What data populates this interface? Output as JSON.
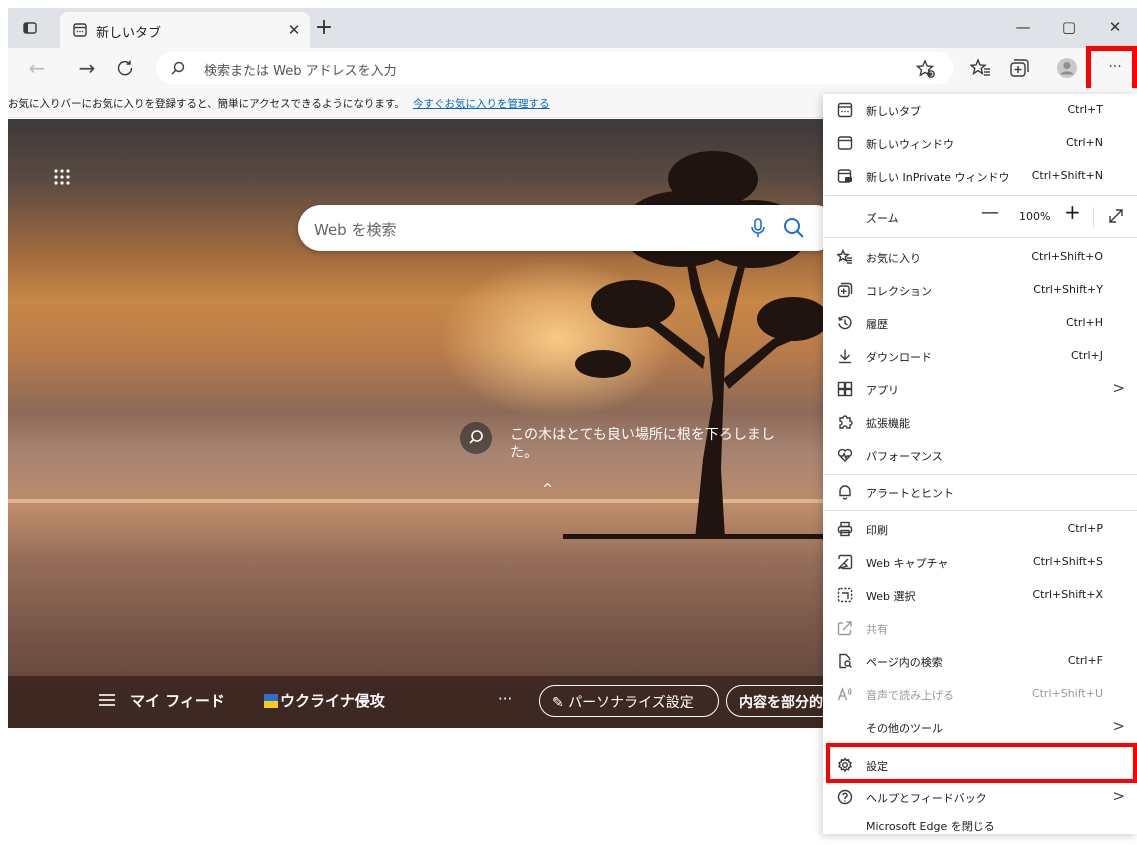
{
  "tab": {
    "title": "新しいタブ"
  },
  "window_controls": {
    "minimize": "—",
    "maximize": "▢",
    "close": "✕"
  },
  "address_bar": {
    "placeholder": "検索または Web アドレスを入力"
  },
  "favorites_bar": {
    "message": "お気に入りバーにお気に入りを登録すると、簡単にアクセスできるようになります。",
    "link": "今すぐお気に入りを管理する"
  },
  "page": {
    "search_placeholder": "Web を検索",
    "caption": "この木はとても良い場所に根を下ろしました。",
    "footer": {
      "my_feed": "マイ フィード",
      "topic": "ウクライナ侵攻",
      "more": "···",
      "personalize": "パーソナライズ設定",
      "content": "内容を部分的に表示"
    }
  },
  "menu": {
    "new_tab": {
      "label": "新しいタブ",
      "shortcut": "Ctrl+T"
    },
    "new_window": {
      "label": "新しいウィンドウ",
      "shortcut": "Ctrl+N"
    },
    "new_inprivate": {
      "label": "新しい InPrivate ウィンドウ",
      "shortcut": "Ctrl+Shift+N"
    },
    "zoom": {
      "label": "ズーム",
      "value": "100%",
      "minus": "—",
      "plus": "+"
    },
    "favorites": {
      "label": "お気に入り",
      "shortcut": "Ctrl+Shift+O"
    },
    "collections": {
      "label": "コレクション",
      "shortcut": "Ctrl+Shift+Y"
    },
    "history": {
      "label": "履歴",
      "shortcut": "Ctrl+H"
    },
    "downloads": {
      "label": "ダウンロード",
      "shortcut": "Ctrl+J"
    },
    "apps": {
      "label": "アプリ",
      "arrow": ">"
    },
    "extensions": {
      "label": "拡張機能"
    },
    "performance": {
      "label": "パフォーマンス"
    },
    "alerts": {
      "label": "アラートとヒント"
    },
    "print": {
      "label": "印刷",
      "shortcut": "Ctrl+P"
    },
    "web_capture": {
      "label": "Web キャプチャ",
      "shortcut": "Ctrl+Shift+S"
    },
    "web_select": {
      "label": "Web 選択",
      "shortcut": "Ctrl+Shift+X"
    },
    "share": {
      "label": "共有"
    },
    "find": {
      "label": "ページ内の検索",
      "shortcut": "Ctrl+F"
    },
    "read_aloud": {
      "label": "音声で読み上げる",
      "shortcut": "Ctrl+Shift+U"
    },
    "more_tools": {
      "label": "その他のツール",
      "arrow": ">"
    },
    "settings": {
      "label": "設定"
    },
    "help": {
      "label": "ヘルプとフィードバック",
      "arrow": ">"
    },
    "close_edge": {
      "label": "Microsoft Edge を閉じる"
    }
  },
  "colors": {
    "highlight": "#ff0000",
    "link": "#0066cc",
    "menu_bg": "#ffffff"
  }
}
